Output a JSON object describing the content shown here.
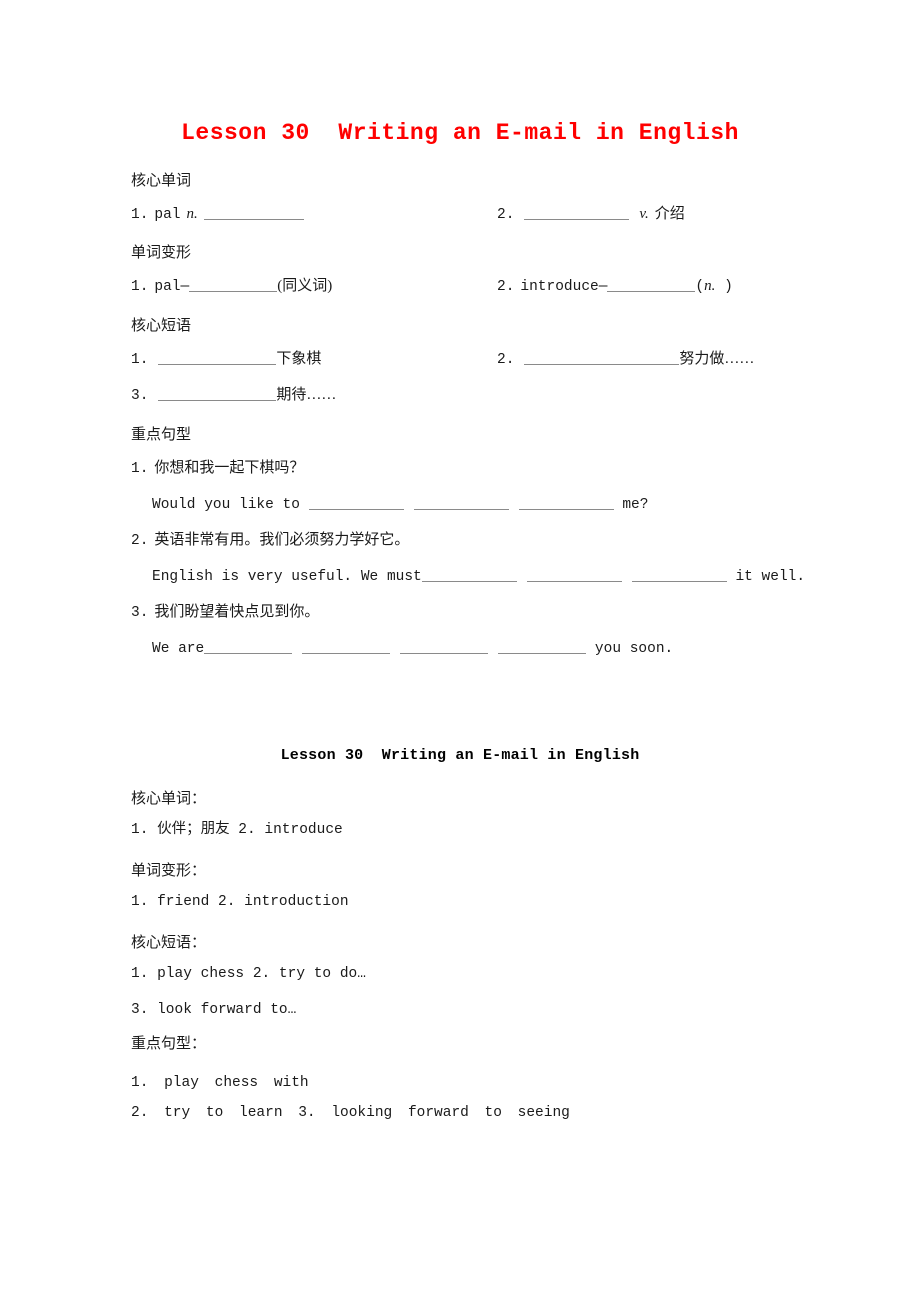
{
  "document": {
    "worksheet_title": "Lesson 30  Writing an E-mail in English",
    "answerkey_title": "Lesson 30  Writing an E-mail in English",
    "title_color": "#ff0000"
  },
  "worksheet": {
    "sections": [
      {
        "heading": "核心单词",
        "items_left": [
          {
            "num": "1.",
            "text": "pal",
            "pos": "n.",
            "after": ""
          }
        ],
        "items_right": [
          {
            "num": "2.",
            "text": "",
            "pos": "v.",
            "after": "介绍"
          }
        ]
      },
      {
        "heading": "单词变形",
        "items_left": [
          {
            "num": "1.",
            "text": "pal—",
            "after": "(同义词)"
          }
        ],
        "items_right": [
          {
            "num": "2.",
            "text": "introduce—",
            "after_open": "(",
            "pos": "n.",
            "after_close": " )"
          }
        ]
      },
      {
        "heading": "核心短语",
        "items": [
          {
            "num": "1.",
            "after": "下象棋"
          },
          {
            "num": "2.",
            "after": "努力做……"
          },
          {
            "num": "3.",
            "after": "期待……"
          }
        ]
      },
      {
        "heading": "重点句型",
        "sentences": [
          {
            "num": "1.",
            "chinese": "你想和我一起下棋吗？",
            "english_before": "Would you like to ",
            "english_after": " me?",
            "blanks": 3
          },
          {
            "num": "2.",
            "chinese": "英语非常有用。我们必须努力学好它。",
            "english_before": "English is very useful. We must",
            "english_after": " it well.",
            "blanks": 3
          },
          {
            "num": "3.",
            "chinese": "我们盼望着快点见到你。",
            "english_before": "We are",
            "english_after": " you soon.",
            "blanks": 4
          }
        ]
      }
    ]
  },
  "answerkey": {
    "sections": [
      {
        "heading": "核心单词：",
        "lines": [
          "1. 伙伴；朋友  2. introduce"
        ]
      },
      {
        "heading": "单词变形：",
        "lines": [
          "1. friend  2. introduction"
        ]
      },
      {
        "heading": "核心短语：",
        "lines": [
          "1. play chess  2. try to do…",
          "3. look forward to…"
        ]
      },
      {
        "heading": "重点句型：",
        "lines": [
          "1. play  chess  with",
          "2. try  to  learn 3. looking  forward  to  seeing"
        ]
      }
    ]
  }
}
